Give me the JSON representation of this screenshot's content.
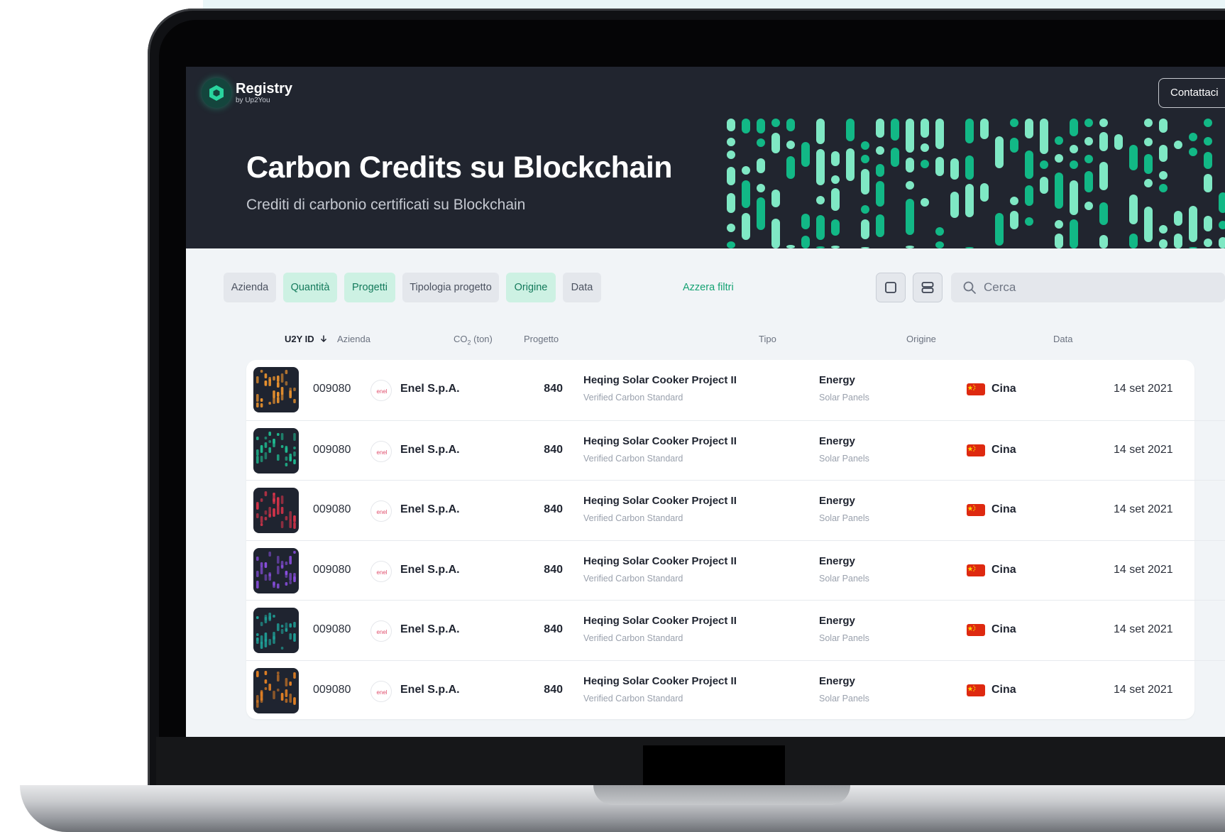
{
  "brand": {
    "name": "Registry",
    "sub": "by Up2You"
  },
  "header": {
    "contact_label": "Contattaci"
  },
  "hero": {
    "title": "Carbon Credits su Blockchain",
    "subtitle": "Crediti di carbonio certificati su Blockchain"
  },
  "filters": {
    "chips": [
      {
        "label": "Azienda",
        "active": false
      },
      {
        "label": "Quantità",
        "active": true
      },
      {
        "label": "Progetti",
        "active": true
      },
      {
        "label": "Tipologia progetto",
        "active": false
      },
      {
        "label": "Origine",
        "active": true
      },
      {
        "label": "Data",
        "active": false
      }
    ],
    "reset_label": "Azzera filtri"
  },
  "search": {
    "placeholder": "Cerca",
    "icon": "search-icon"
  },
  "view_toggle": {
    "single_icon": "square-view-icon",
    "list_icon": "list-view-icon"
  },
  "table": {
    "columns": {
      "id": "U2Y ID",
      "company": "Azienda",
      "co2_prefix": "CO",
      "co2_sub": "2",
      "co2_suffix": " (ton)",
      "project": "Progetto",
      "type": "Tipo",
      "origin": "Origine",
      "date": "Data"
    },
    "sort_icon": "arrow-down-icon",
    "rows": [
      {
        "id": "009080",
        "company": "Enel S.p.A.",
        "company_logo_text": "enel",
        "quantity": "840",
        "project": "Heqing Solar Cooker Project II",
        "standard": "Verified Carbon Standard",
        "type": "Energy",
        "subtype": "Solar Panels",
        "origin": "Cina",
        "date": "14 set 2021",
        "thumb_color": "#e8912e"
      },
      {
        "id": "009080",
        "company": "Enel S.p.A.",
        "company_logo_text": "enel",
        "quantity": "840",
        "project": "Heqing Solar Cooker Project II",
        "standard": "Verified Carbon Standard",
        "type": "Energy",
        "subtype": "Solar Panels",
        "origin": "Cina",
        "date": "14 set 2021",
        "thumb_color": "#1fbf93"
      },
      {
        "id": "009080",
        "company": "Enel S.p.A.",
        "company_logo_text": "enel",
        "quantity": "840",
        "project": "Heqing Solar Cooker Project II",
        "standard": "Verified Carbon Standard",
        "type": "Energy",
        "subtype": "Solar Panels",
        "origin": "Cina",
        "date": "14 set 2021",
        "thumb_color": "#d9344a"
      },
      {
        "id": "009080",
        "company": "Enel S.p.A.",
        "company_logo_text": "enel",
        "quantity": "840",
        "project": "Heqing Solar Cooker Project II",
        "standard": "Verified Carbon Standard",
        "type": "Energy",
        "subtype": "Solar Panels",
        "origin": "Cina",
        "date": "14 set 2021",
        "thumb_color": "#8a4fe0"
      },
      {
        "id": "009080",
        "company": "Enel S.p.A.",
        "company_logo_text": "enel",
        "quantity": "840",
        "project": "Heqing Solar Cooker Project II",
        "standard": "Verified Carbon Standard",
        "type": "Energy",
        "subtype": "Solar Panels",
        "origin": "Cina",
        "date": "14 set 2021",
        "thumb_color": "#1fa39a"
      },
      {
        "id": "009080",
        "company": "Enel S.p.A.",
        "company_logo_text": "enel",
        "quantity": "840",
        "project": "Heqing Solar Cooker Project II",
        "standard": "Verified Carbon Standard",
        "type": "Energy",
        "subtype": "Solar Panels",
        "origin": "Cina",
        "date": "14 set 2021",
        "thumb_color": "#e07f24"
      }
    ]
  },
  "colors": {
    "accent": "#15a273",
    "hero_bg": "#21252f",
    "pattern_green": "#12b886",
    "pattern_mint": "#7fe8c4",
    "flag_red": "#de2910",
    "flag_yellow": "#ffde00"
  }
}
